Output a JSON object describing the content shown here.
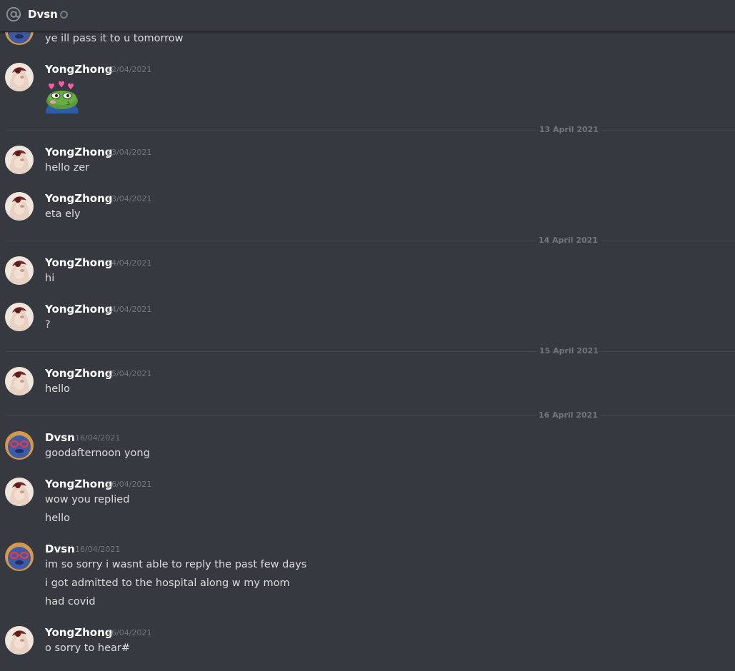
{
  "header": {
    "title": "Dvsn",
    "at_icon": "at-sign-icon",
    "status": "offline"
  },
  "colors": {
    "background": "#36393f",
    "username": "#ffffff",
    "message_text": "#dcddde",
    "muted": "#72767d",
    "divider": "#42454a"
  },
  "messages": [
    {
      "author": "",
      "timestamp": "",
      "lines": [
        "ye ill pass it to u tomorrow"
      ]
    },
    {
      "author": "YongZhong",
      "timestamp": "12/04/2021",
      "lines": [],
      "emote": "pepe-love-emote"
    },
    {
      "author": "YongZhong",
      "timestamp": "13/04/2021",
      "lines": [
        "hello zer"
      ]
    },
    {
      "author": "YongZhong",
      "timestamp": "13/04/2021",
      "lines": [
        "eta ely"
      ]
    },
    {
      "author": "YongZhong",
      "timestamp": "14/04/2021",
      "lines": [
        "hi"
      ]
    },
    {
      "author": "YongZhong",
      "timestamp": "14/04/2021",
      "lines": [
        "?"
      ]
    },
    {
      "author": "YongZhong",
      "timestamp": "15/04/2021",
      "lines": [
        "hello"
      ]
    },
    {
      "author": "Dvsn",
      "timestamp": "16/04/2021",
      "lines": [
        "goodafternoon yong"
      ]
    },
    {
      "author": "YongZhong",
      "timestamp": "16/04/2021",
      "lines": [
        "wow you replied",
        "hello"
      ]
    },
    {
      "author": "Dvsn",
      "timestamp": "16/04/2021",
      "lines": [
        "im so sorry i wasnt able to reply the past few days",
        "i got admitted to the hospital along w my mom",
        "had covid"
      ]
    },
    {
      "author": "YongZhong",
      "timestamp": "16/04/2021",
      "lines": [
        "o sorry to hear#"
      ]
    }
  ],
  "dividers": [
    "13 April 2021",
    "14 April 2021",
    "15 April 2021",
    "16 April 2021"
  ]
}
